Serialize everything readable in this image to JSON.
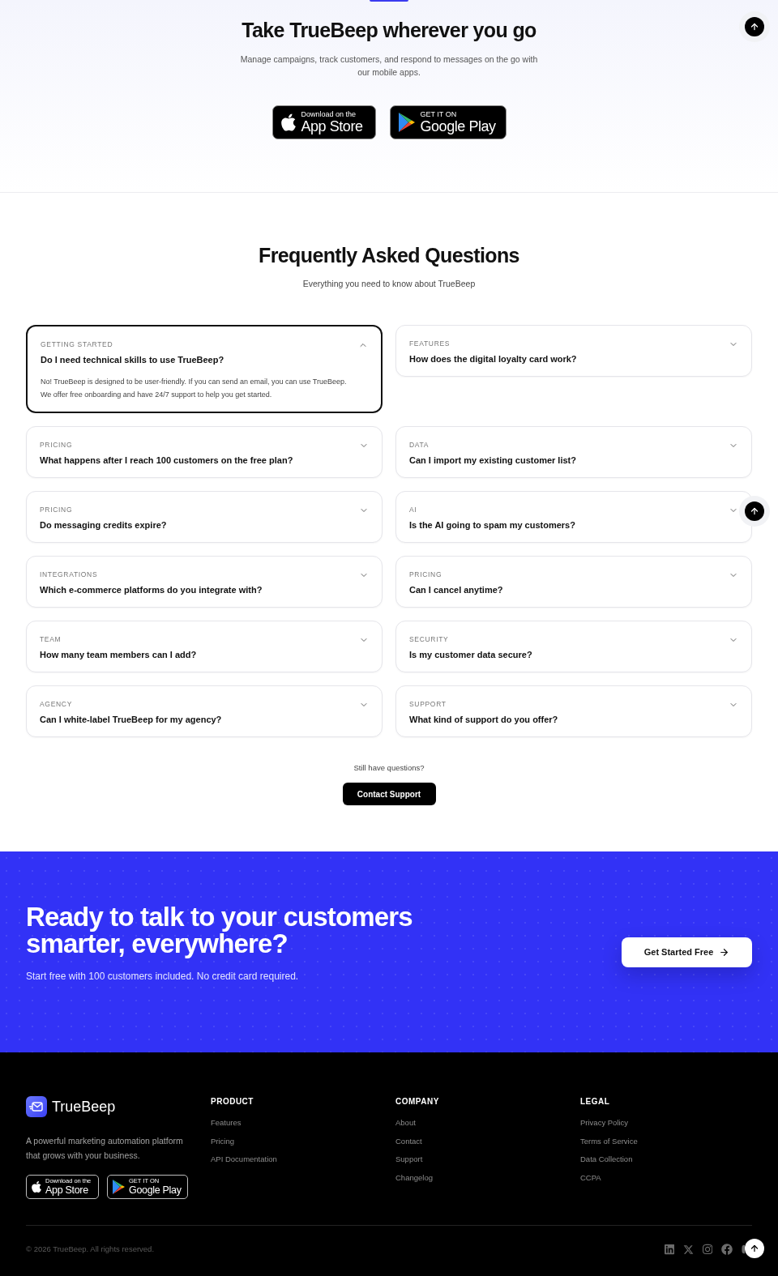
{
  "mobile_apps": {
    "title": "Take TrueBeep wherever you go",
    "subtitle": "Manage campaigns, track customers, and respond to messages on the go with our mobile apps.",
    "badges": [
      {
        "kind": "apple",
        "small": "Download on the",
        "large": "App Store"
      },
      {
        "kind": "google",
        "small": "GET IT ON",
        "large": "Google Play"
      }
    ]
  },
  "faq": {
    "title": "Frequently Asked Questions",
    "subtitle": "Everything you need to know about TrueBeep",
    "items": [
      {
        "category": "GETTING STARTED",
        "question": "Do I need technical skills to use TrueBeep?",
        "expanded": true,
        "answer": "No! TrueBeep is designed to be user-friendly. If you can send an email, you can use TrueBeep. We offer free onboarding and have 24/7 support to help you get started."
      },
      {
        "category": "FEATURES",
        "question": "How does the digital loyalty card work?",
        "expanded": false
      },
      {
        "category": "PRICING",
        "question": "What happens after I reach 100 customers on the free plan?",
        "expanded": false
      },
      {
        "category": "DATA",
        "question": "Can I import my existing customer list?",
        "expanded": false
      },
      {
        "category": "PRICING",
        "question": "Do messaging credits expire?",
        "expanded": false
      },
      {
        "category": "AI",
        "question": "Is the AI going to spam my customers?",
        "expanded": false
      },
      {
        "category": "INTEGRATIONS",
        "question": "Which e-commerce platforms do you integrate with?",
        "expanded": false
      },
      {
        "category": "PRICING",
        "question": "Can I cancel anytime?",
        "expanded": false
      },
      {
        "category": "TEAM",
        "question": "How many team members can I add?",
        "expanded": false
      },
      {
        "category": "SECURITY",
        "question": "Is my customer data secure?",
        "expanded": false
      },
      {
        "category": "AGENCY",
        "question": "Can I white-label TrueBeep for my agency?",
        "expanded": false
      },
      {
        "category": "SUPPORT",
        "question": "What kind of support do you offer?",
        "expanded": false
      }
    ],
    "prompt": "Still have questions?",
    "button": "Contact Support"
  },
  "cta": {
    "title": "Ready to talk to your customers smarter, everywhere?",
    "subtitle": "Start free with 100 customers included. No credit card required.",
    "button": "Get Started Free"
  },
  "footer": {
    "brand": "TrueBeep",
    "description": "A powerful marketing automation platform that grows with your business.",
    "badges": [
      {
        "kind": "apple",
        "small": "Download on the",
        "large": "App Store"
      },
      {
        "kind": "google",
        "small": "GET IT ON",
        "large": "Google Play"
      }
    ],
    "columns": [
      {
        "heading": "PRODUCT",
        "links": [
          "Features",
          "Pricing",
          "API Documentation"
        ]
      },
      {
        "heading": "COMPANY",
        "links": [
          "About",
          "Contact",
          "Support",
          "Changelog"
        ]
      },
      {
        "heading": "LEGAL",
        "links": [
          "Privacy Policy",
          "Terms of Service",
          "Data Collection",
          "CCPA"
        ]
      }
    ],
    "copyright": "© 2026 TrueBeep. All rights reserved."
  }
}
